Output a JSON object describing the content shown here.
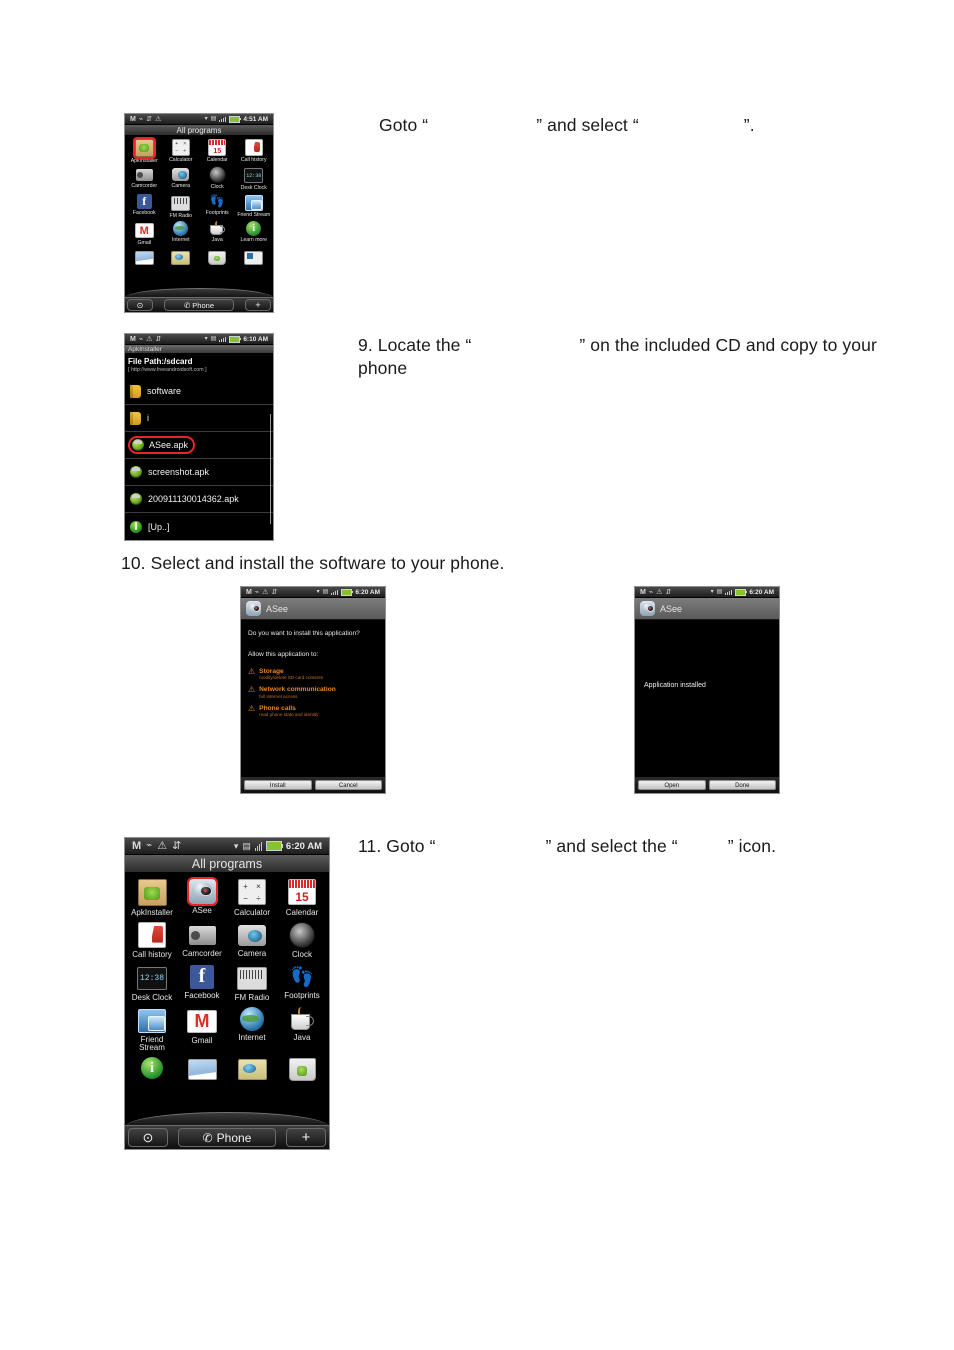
{
  "document": {
    "type": "user-manual-page",
    "background": "#ffffff"
  },
  "instructions": [
    {
      "id": "step-goto-allprograms",
      "prefix": "Goto “",
      "blank1": "",
      "middle": "” and select “",
      "blank2": "",
      "suffix": "”."
    },
    {
      "id": "step-9",
      "prefix": "9. Locate the “",
      "blank1": "",
      "middle": "” on the included CD and copy to your",
      "line2": "phone"
    },
    {
      "id": "step-10",
      "text": "10. Select and install the software to your phone."
    },
    {
      "id": "step-11",
      "prefix": "11. Goto “",
      "blank1": "",
      "middle": "” and select the “",
      "blank2": "",
      "suffix": "” icon."
    }
  ],
  "screens": {
    "all_programs_small": {
      "name": "All programs (small)",
      "statusbar": {
        "time": "4:51 AM",
        "icons": [
          "gmail-icon",
          "sync-icon",
          "usb-icon",
          "alert-icon",
          "wifi-icon",
          "sd-icon",
          "signal-icon",
          "battery-icon"
        ]
      },
      "title": "All programs",
      "apps": [
        {
          "label": "ApkInstaller",
          "icon": "apk-installer-icon",
          "highlighted": true
        },
        {
          "label": "Calculator",
          "icon": "calculator-icon",
          "highlighted": false
        },
        {
          "label": "Calendar",
          "icon": "calendar-icon",
          "highlighted": false
        },
        {
          "label": "Call history",
          "icon": "call-history-icon",
          "highlighted": false
        },
        {
          "label": "Camcorder",
          "icon": "camcorder-icon",
          "highlighted": false
        },
        {
          "label": "Camera",
          "icon": "camera-icon",
          "highlighted": false
        },
        {
          "label": "Clock",
          "icon": "clock-icon",
          "highlighted": false
        },
        {
          "label": "Desk Clock",
          "icon": "desk-clock-icon",
          "highlighted": false
        },
        {
          "label": "Facebook",
          "icon": "facebook-icon",
          "highlighted": false
        },
        {
          "label": "FM Radio",
          "icon": "fm-radio-icon",
          "highlighted": false
        },
        {
          "label": "Footprints",
          "icon": "footprints-icon",
          "highlighted": false
        },
        {
          "label": "Friend Stream",
          "icon": "friend-stream-icon",
          "highlighted": false
        },
        {
          "label": "Gmail",
          "icon": "gmail-icon",
          "highlighted": false
        },
        {
          "label": "Internet",
          "icon": "internet-icon",
          "highlighted": false
        },
        {
          "label": "Java",
          "icon": "java-icon",
          "highlighted": false
        },
        {
          "label": "Learn more",
          "icon": "learn-more-icon",
          "highlighted": false
        }
      ],
      "partial_row": [
        "mail-icon",
        "maps-icon",
        "market-icon",
        "news-icon"
      ],
      "dock": {
        "left": "chevron-down-icon",
        "center": "Phone",
        "center_icon": "phone-icon",
        "right": "plus-icon"
      },
      "calendar_day": "15",
      "desk_clock_time": "12:38"
    },
    "file_browser": {
      "name": "ApkInstaller file browser",
      "statusbar": {
        "time": "6:10 AM"
      },
      "app_title": "ApkInstaller",
      "path_label": "File Path:/sdcard",
      "path_url": "[ http://www.freeandroidsoft.com ]",
      "files": [
        {
          "name": "software",
          "type": "folder",
          "highlighted": false
        },
        {
          "name": "i",
          "type": "folder",
          "highlighted": false
        },
        {
          "name": "ASee.apk",
          "type": "apk",
          "highlighted": true
        },
        {
          "name": "screenshot.apk",
          "type": "apk",
          "highlighted": false
        },
        {
          "name": "200911130014362.apk",
          "type": "apk",
          "highlighted": false
        },
        {
          "name": "[Up..]",
          "type": "up",
          "highlighted": false
        }
      ]
    },
    "install_dialog": {
      "name": "ASee install permissions dialog",
      "statusbar": {
        "time": "6:20 AM"
      },
      "app_name": "ASee",
      "app_icon": "asee-icon",
      "question": "Do you want to install this application?",
      "allow_label": "Allow this application to:",
      "permissions": [
        {
          "name": "Storage",
          "desc": "modify/delete SD card contents",
          "icon": "warning-icon"
        },
        {
          "name": "Network communication",
          "desc": "full Internet access",
          "icon": "warning-icon"
        },
        {
          "name": "Phone calls",
          "desc": "read phone state and identity",
          "icon": "warning-icon"
        }
      ],
      "buttons": [
        {
          "label": "Install",
          "name": "install-button"
        },
        {
          "label": "Cancel",
          "name": "cancel-button"
        }
      ]
    },
    "installed_dialog": {
      "name": "ASee application installed dialog",
      "statusbar": {
        "time": "6:20 AM"
      },
      "app_name": "ASee",
      "app_icon": "asee-icon",
      "message": "Application installed",
      "buttons": [
        {
          "label": "Open",
          "name": "open-button"
        },
        {
          "label": "Done",
          "name": "done-button"
        }
      ]
    },
    "all_programs_large": {
      "name": "All programs (large, with ASee installed)",
      "statusbar": {
        "time": "6:20 AM",
        "icons": [
          "gmail-icon",
          "sync-icon",
          "alert-icon",
          "usb-icon",
          "wifi-icon",
          "sd-icon",
          "signal-icon",
          "battery-icon"
        ]
      },
      "title": "All programs",
      "apps": [
        {
          "label": "ApkInstaller",
          "icon": "apk-installer-icon",
          "highlighted": false
        },
        {
          "label": "ASee",
          "icon": "asee-icon",
          "highlighted": true
        },
        {
          "label": "Calculator",
          "icon": "calculator-icon",
          "highlighted": false
        },
        {
          "label": "Calendar",
          "icon": "calendar-icon",
          "highlighted": false
        },
        {
          "label": "Call history",
          "icon": "call-history-icon",
          "highlighted": false
        },
        {
          "label": "Camcorder",
          "icon": "camcorder-icon",
          "highlighted": false
        },
        {
          "label": "Camera",
          "icon": "camera-icon",
          "highlighted": false
        },
        {
          "label": "Clock",
          "icon": "clock-icon",
          "highlighted": false
        },
        {
          "label": "Desk Clock",
          "icon": "desk-clock-icon",
          "highlighted": false
        },
        {
          "label": "Facebook",
          "icon": "facebook-icon",
          "highlighted": false
        },
        {
          "label": "FM Radio",
          "icon": "fm-radio-icon",
          "highlighted": false
        },
        {
          "label": "Footprints",
          "icon": "footprints-icon",
          "highlighted": false
        },
        {
          "label": "Friend Stream",
          "icon": "friend-stream-icon",
          "highlighted": false
        },
        {
          "label": "Gmail",
          "icon": "gmail-icon",
          "highlighted": false
        },
        {
          "label": "Internet",
          "icon": "internet-icon",
          "highlighted": false
        },
        {
          "label": "Java",
          "icon": "java-icon",
          "highlighted": false
        }
      ],
      "partial_row": [
        "learn-more-icon",
        "mail-icon",
        "maps-icon",
        "market-icon"
      ],
      "dock": {
        "left": "chevron-down-icon",
        "center": "Phone",
        "center_icon": "phone-icon",
        "right": "plus-icon"
      },
      "calendar_day": "15",
      "desk_clock_time": "12:38"
    }
  },
  "colors": {
    "highlight_red": "#e8242a",
    "permission_orange": "#e8872a",
    "battery_green": "#86c232",
    "facebook_blue": "#3b5998",
    "page_background": "#ffffff"
  }
}
